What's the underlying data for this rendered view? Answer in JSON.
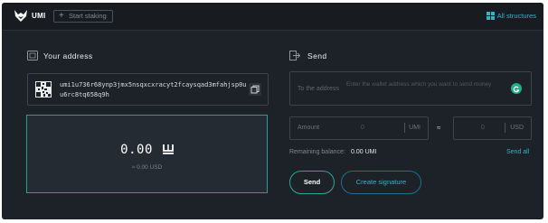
{
  "header": {
    "brand": "UMI",
    "staking_tab_label": "Start staking",
    "all_structures_label": "All structures"
  },
  "wallet": {
    "title": "Your address",
    "address": "umi1u736r68ynp3jmx5nsqxcxracyt2fcaysqad3mfahjsp0uu6rc8tq658q9h",
    "balance": "0.00",
    "balance_usd": "≈ 0.00 USD"
  },
  "send": {
    "title": "Send",
    "to_label": "To the address",
    "to_placeholder": "Enter the wallet address which you want to send money",
    "amount_label": "Amount",
    "amount_value": "0",
    "amount_unit": "UMI",
    "approx_symbol": "≈",
    "usd_value": "0",
    "usd_unit": "USD",
    "remaining_label": "Remaining balance:",
    "remaining_value": "0.00 UMI",
    "send_all_label": "Send all",
    "send_button": "Send",
    "create_signature_button": "Create signature"
  },
  "icons": {
    "logo": "umi-fox-logo-icon",
    "plus": "plus-icon",
    "grid": "grid-icon",
    "wallet": "wallet-icon",
    "send": "send-arrow-icon",
    "qr": "qr-code-icon",
    "copy": "copy-icon",
    "grammarly": "grammarly-icon"
  },
  "colors": {
    "background": "#1d2228",
    "topbar": "#181c21",
    "accent_teal": "#2ba596",
    "link_cyan": "#2fb5c7",
    "balance_border": "#25a194"
  }
}
